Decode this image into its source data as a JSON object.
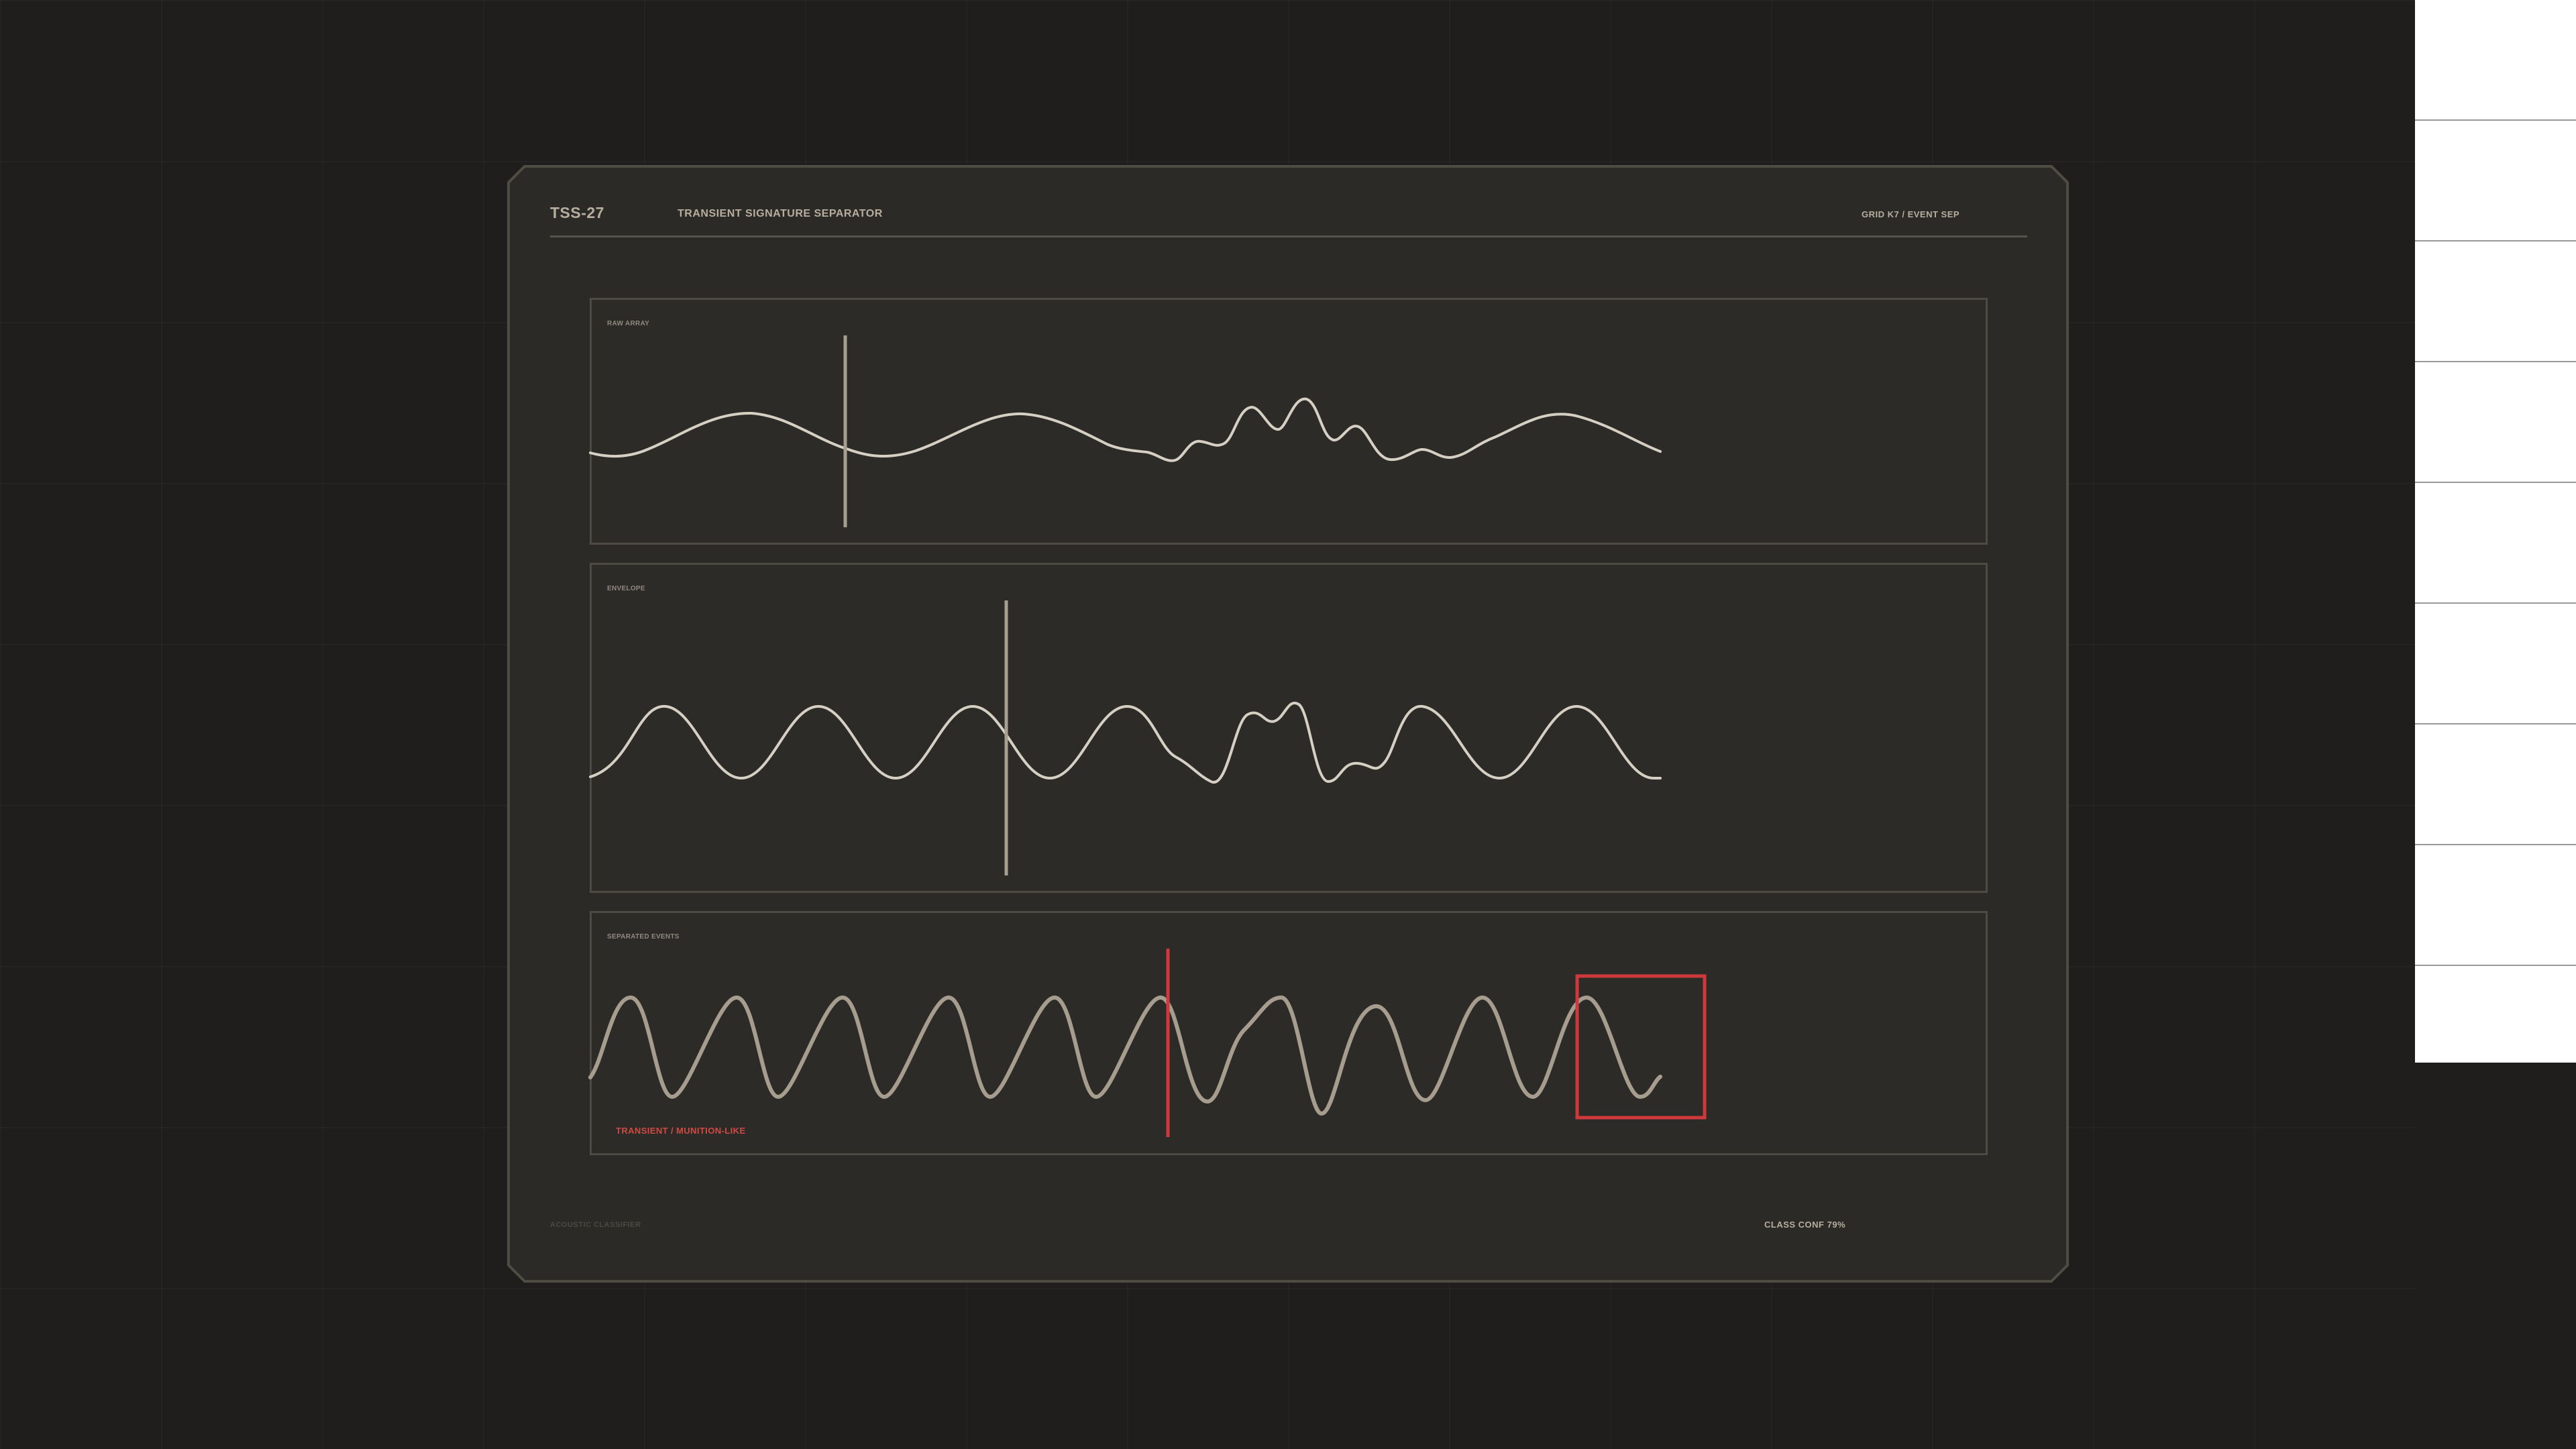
{
  "device": {
    "model": "TSS-27",
    "title": "TRANSIENT SIGNATURE SEPARATOR",
    "grid_event": "GRID K7 / EVENT SEP"
  },
  "panels": {
    "raw": {
      "label": "RAW ARRAY"
    },
    "envelope": {
      "label": "ENVELOPE"
    },
    "separated": {
      "label": "SEPARATED EVENTS",
      "classification": "TRANSIENT / MUNITION-LIKE"
    }
  },
  "footer": {
    "left": "ACOUSTIC CLASSIFIER",
    "right": "CLASS CONF 79%"
  },
  "colors": {
    "background": "#1f1e1c",
    "device": "#2b2a27",
    "panel": "#2d2b28",
    "border": "#4d4b44",
    "trace": "#d6d0c4",
    "separated_trace": "#a69d8e",
    "alert": "#d0393c",
    "text": "#b7ae9f"
  }
}
